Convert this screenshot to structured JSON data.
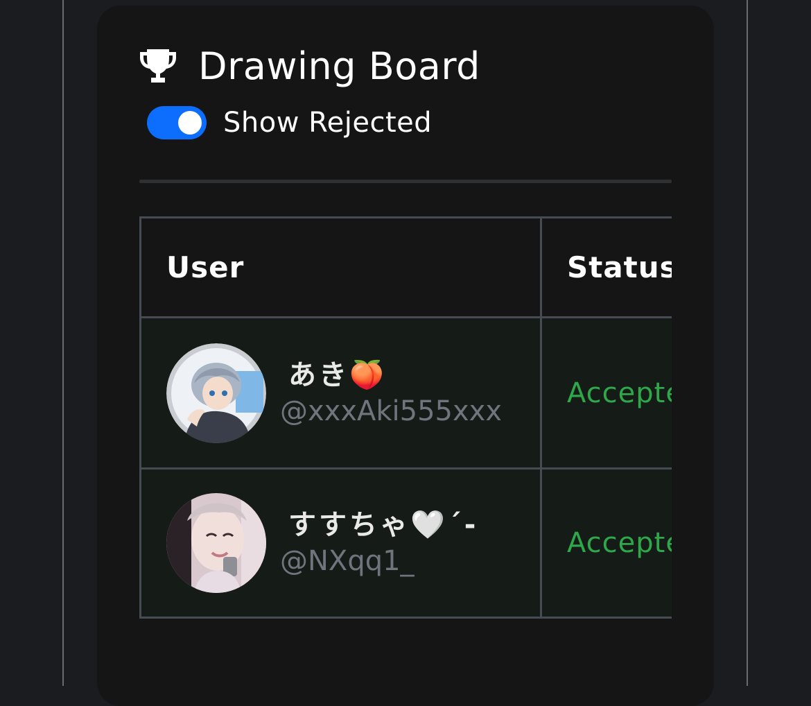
{
  "card": {
    "title": "Drawing Board",
    "title_icon": "trophy-icon"
  },
  "toggle": {
    "label": "Show Rejected",
    "checked": true,
    "color": "#0d6efd"
  },
  "table": {
    "columns": [
      "User",
      "Status"
    ],
    "rows": [
      {
        "display_name": "あき🍑",
        "handle": "@xxxAki555xxx",
        "status": "Accepted"
      },
      {
        "display_name": "すすちゃ🤍´-",
        "handle": "@NXqq1_",
        "status": "Accepted"
      }
    ]
  },
  "colors": {
    "accepted": "#2fa84a",
    "row_background": "#151c17",
    "card_background": "#151516"
  }
}
